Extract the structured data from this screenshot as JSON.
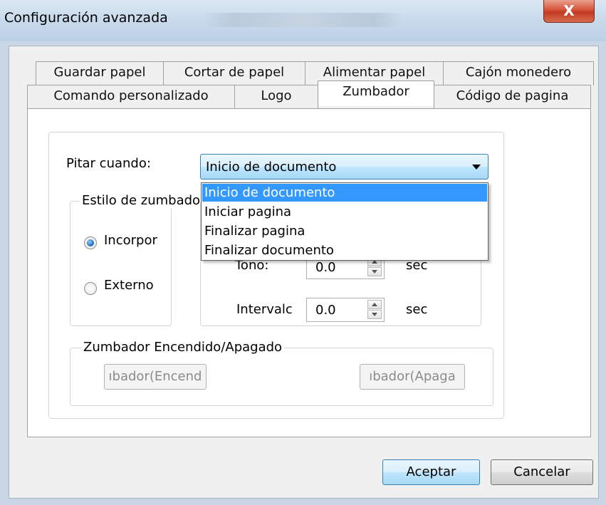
{
  "window": {
    "title": "Configuración avanzada",
    "close_label": "X"
  },
  "tabs_row1": [
    "Guardar papel",
    "Cortar de papel",
    "Alimentar papel",
    "Cajón monedero"
  ],
  "tabs_row2": [
    "Comando personalizado",
    "Logo",
    "Zumbador",
    "Código de pagina"
  ],
  "active_tab": "Zumbador",
  "beep": {
    "label": "Pitar cuando:",
    "selected": "Inicio de documento",
    "options": [
      "Inicio de documento",
      "Iniciar pagina",
      "Finalizar pagina",
      "Finalizar documento"
    ]
  },
  "style_group": {
    "legend": "Estilo de zumbado",
    "internal": "Incorpor",
    "external": "Externo",
    "selected": "Incorpor"
  },
  "tone": {
    "label": "Tono:",
    "value": "0.0",
    "unit": "sec"
  },
  "interval": {
    "label": "Intervalc",
    "value": "0.0",
    "unit": "sec"
  },
  "onoff_group": {
    "legend": "Zumbador Encendido/Apagado",
    "on_button": "ıbador(Encend",
    "off_button": "ıbador(Apaga"
  },
  "buttons": {
    "ok": "Aceptar",
    "cancel": "Cancelar"
  }
}
